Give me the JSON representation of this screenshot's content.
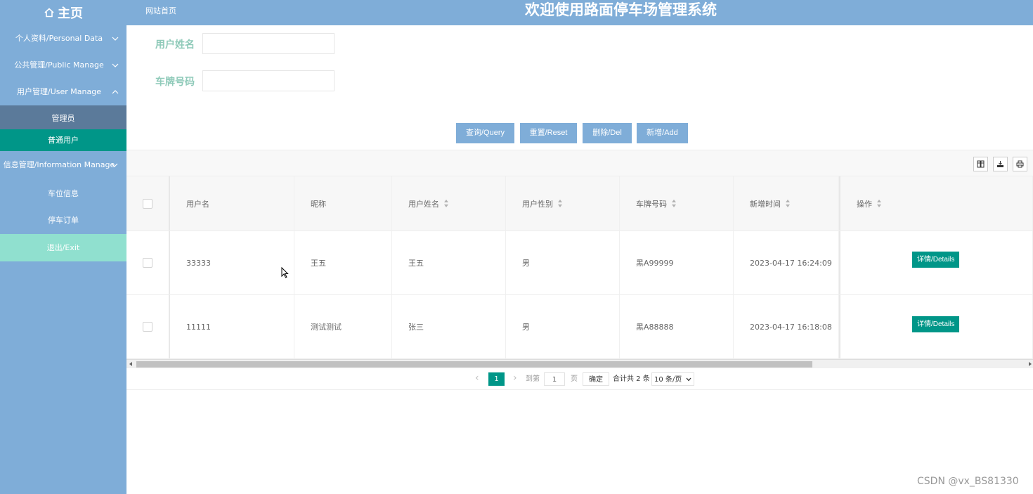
{
  "header": {
    "home_label": "主页",
    "site_link": "网站首页",
    "title": "欢迎使用路面停车场管理系统"
  },
  "sidebar": {
    "items": [
      {
        "label": "个人资料/Personal Data"
      },
      {
        "label": "公共管理/Public Manage"
      },
      {
        "label": "用户管理/User Manage"
      }
    ],
    "submenu": [
      {
        "label": "管理员"
      },
      {
        "label": "普通用户"
      }
    ],
    "info_manage": "信息管理/Information Manage",
    "info_sub": [
      {
        "label": "车位信息"
      },
      {
        "label": "停车订单"
      }
    ],
    "exit": "退出/Exit"
  },
  "search": {
    "name_label": "用户姓名",
    "name_value": "",
    "plate_label": "车牌号码",
    "plate_value": ""
  },
  "buttons": {
    "query": "查询/Query",
    "reset": "重置/Reset",
    "delete": "删除/Del",
    "add": "新增/Add"
  },
  "table": {
    "columns": [
      "用户名",
      "昵称",
      "用户姓名",
      "用户性别",
      "车牌号码",
      "新增时间",
      "操作"
    ],
    "rows": [
      {
        "username": "33333",
        "nickname": "王五",
        "realname": "王五",
        "gender": "男",
        "plate": "黑A99999",
        "created": "2023-04-17 16:24:09",
        "action": "详情/Details"
      },
      {
        "username": "11111",
        "nickname": "测试测试",
        "realname": "张三",
        "gender": "男",
        "plate": "黑A88888",
        "created": "2023-04-17 16:18:08",
        "action": "详情/Details"
      }
    ]
  },
  "pager": {
    "current": "1",
    "goto_label": "到第",
    "goto_value": "1",
    "page_unit": "页",
    "confirm": "确定",
    "total": "合计共 2 条",
    "per_page": "10 条/页"
  },
  "watermark": "CSDN @vx_BS81330",
  "colors": {
    "sidebar_bg": "#7fadd8",
    "active_item": "#009688",
    "exit_bg": "#90e0cf",
    "label_color": "#8fcab9"
  }
}
